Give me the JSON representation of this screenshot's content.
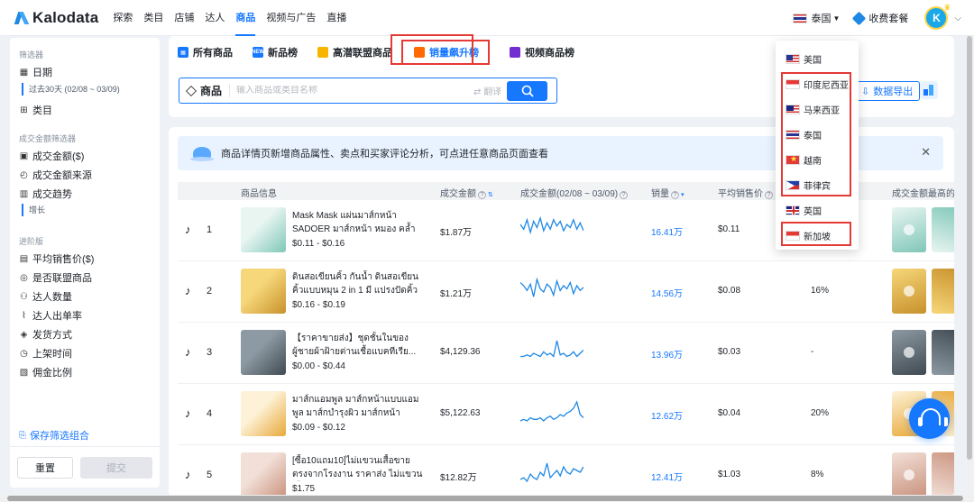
{
  "app": {
    "name": "Kalodata"
  },
  "nav": {
    "items": [
      "探索",
      "类目",
      "店铺",
      "达人",
      "商品",
      "视频与广告",
      "直播"
    ],
    "active_index": 4
  },
  "topbar": {
    "country": "泰国",
    "subscription": "收费套餐",
    "avatar_letter": "K"
  },
  "sidebar": {
    "filters_title": "筛选器",
    "date_label": "日期",
    "date_value": "过去30天 (02/08 ~ 03/09)",
    "category_label": "类目",
    "gmv_filter_title": "成交金额筛选器",
    "gmv_items": [
      "成交金额($)",
      "成交金额来源",
      "成交趋势"
    ],
    "trend_value": "增长",
    "advanced_title": "进阶版",
    "advanced_items": [
      "平均销售价($)",
      "是否联盟商品",
      "达人数量",
      "达人出单率",
      "发货方式",
      "上架时间",
      "佣金比例"
    ],
    "save_combo": "保存筛选组合",
    "reset": "重置",
    "submit": "提交"
  },
  "tabs": [
    {
      "label": "所有商品",
      "icon": "all-products-icon",
      "color": "#1677ff"
    },
    {
      "label": "新品榜",
      "icon": "new-icon",
      "color": "#1677ff"
    },
    {
      "label": "高潜联盟商品",
      "icon": "thumb-up-icon",
      "color": "#f7b500"
    },
    {
      "label": "销量飙升榜",
      "icon": "fire-icon",
      "color": "#ff6a00"
    },
    {
      "label": "视频商品榜",
      "icon": "video-icon",
      "color": "#722ed1"
    }
  ],
  "active_tab": 3,
  "search": {
    "label": "商品",
    "placeholder": "输入商品或类目名称",
    "translate": "翻译"
  },
  "export_label": "数据导出",
  "notice": "商品详情页新增商品属性、卖点和买家评论分析，可点进任意商品页面查看",
  "table": {
    "headers": {
      "info": "商品信息",
      "gmv": "成交金额",
      "gmv_range": "成交金额(02/08 ~ 03/09)",
      "sales": "销量",
      "avg_price": "平均销售价",
      "top_video": "成交金额最高的"
    },
    "rows": [
      {
        "rank": "1",
        "name": "Mask Mask แผ่นมาส์กหน้า SADOER มาส์กหน้า หมอง คล้ำ ใ...",
        "price_range": "$0.11 - $0.16",
        "gmv": "$1.87万",
        "sales": "16.41万",
        "avg_price": "$0.11",
        "rate": "",
        "trend": [
          12,
          9,
          15,
          7,
          14,
          10,
          16,
          8,
          13,
          9,
          15,
          11,
          14,
          8,
          12,
          10,
          15,
          9,
          13,
          8
        ],
        "thumb": [
          "#e9f5f1",
          "#7fc7b8"
        ]
      },
      {
        "rank": "2",
        "name": "ดินสอเขียนคิ้ว กันน้ำ ดินสอเขียนคิ้วแบบหมุน 2 in 1 มี แปรงปัดคิ้วใน...",
        "price_range": "$0.16 - $0.19",
        "gmv": "$1.21万",
        "sales": "14.56万",
        "avg_price": "$0.08",
        "rate": "16%",
        "trend": [
          14,
          12,
          9,
          13,
          5,
          16,
          10,
          8,
          13,
          11,
          6,
          15,
          9,
          12,
          10,
          14,
          7,
          12,
          9,
          11
        ],
        "thumb": [
          "#f6d77a",
          "#c8912b"
        ]
      },
      {
        "rank": "3",
        "name": "【ราคาขายส่ง】ชุดชั้นในของผู้ชายผ้าฝ้ายต่านเชื้อแบคทีเรีย...",
        "price_range": "$0.00 - $0.44",
        "gmv": "$4,129.36",
        "sales": "13.96万",
        "avg_price": "$0.03",
        "rate": "-",
        "trend": [
          6,
          6,
          7,
          6,
          8,
          7,
          6,
          9,
          7,
          8,
          6,
          16,
          7,
          8,
          6,
          7,
          9,
          6,
          8,
          10
        ],
        "thumb": [
          "#8e9aa3",
          "#3f4a52"
        ]
      },
      {
        "rank": "4",
        "name": "มาส์กแอมพูล มาส์กหน้าแบบแอมพูล มาส์กบำรุงผิว มาส์กหน้าแผ่น...",
        "price_range": "$0.09 - $0.12",
        "gmv": "$5,122.63",
        "sales": "12.62万",
        "avg_price": "$0.04",
        "rate": "20%",
        "trend": [
          4,
          5,
          4,
          6,
          5,
          5,
          6,
          4,
          6,
          7,
          5,
          6,
          8,
          7,
          9,
          10,
          12,
          16,
          8,
          6
        ],
        "thumb": [
          "#fdf2d8",
          "#e8a838"
        ]
      },
      {
        "rank": "5",
        "name": "[ซื้อ10แถม10]ไม่แขวนเสื้อขายตรงจากโรงงาน ราคาส่ง ไม่แขวนเสื้อ...",
        "price_range": "$1.75",
        "gmv": "$12.82万",
        "sales": "12.41万",
        "avg_price": "$1.03",
        "rate": "8%",
        "trend": [
          5,
          6,
          4,
          8,
          6,
          5,
          9,
          7,
          14,
          6,
          8,
          10,
          7,
          12,
          9,
          8,
          11,
          10,
          9,
          12
        ],
        "thumb": [
          "#f2e0d8",
          "#c9927d"
        ]
      }
    ]
  },
  "dropdown": {
    "items": [
      {
        "label": "美国",
        "flag": "us"
      },
      {
        "label": "印度尼西亚",
        "flag": "id"
      },
      {
        "label": "马来西亚",
        "flag": "my"
      },
      {
        "label": "泰国",
        "flag": "th"
      },
      {
        "label": "越南",
        "flag": "vn"
      },
      {
        "label": "菲律宾",
        "flag": "ph"
      },
      {
        "label": "英国",
        "flag": "gb"
      },
      {
        "label": "新加坡",
        "flag": "sg"
      }
    ]
  },
  "colors": {
    "accent": "#1677ff",
    "highlight": "#e53935"
  }
}
